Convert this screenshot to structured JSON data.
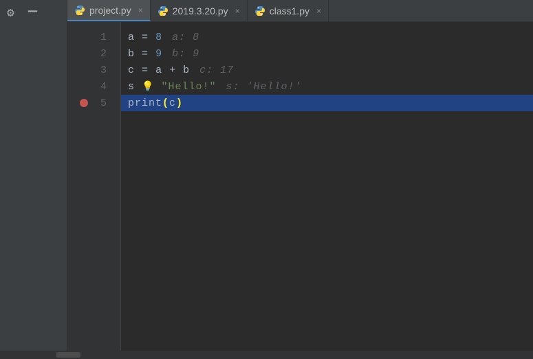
{
  "leftPanel": {
    "gear": "⚙",
    "minimize": "—"
  },
  "tabs": [
    {
      "label": "project.py",
      "active": true
    },
    {
      "label": "2019.3.20.py",
      "active": false
    },
    {
      "label": "class1.py",
      "active": false
    }
  ],
  "gutter": {
    "lines": [
      "1",
      "2",
      "3",
      "4",
      "5"
    ],
    "breakpointLine": 5
  },
  "code": {
    "line1": {
      "v": "a",
      "eq": "=",
      "n": "8",
      "hint": "a: 8"
    },
    "line2": {
      "v": "b",
      "eq": "=",
      "n": "9",
      "hint": "b: 9"
    },
    "line3": {
      "v": "c",
      "eq": "=",
      "a": "a",
      "plus": "+",
      "b": "b",
      "hint": "c: 17"
    },
    "line4": {
      "v": "s",
      "eq": "=",
      "str": "\"Hello!\"",
      "hint": "s: 'Hello!'"
    },
    "line5": {
      "fn": "print",
      "lp": "(",
      "arg": "c",
      "rp": ")"
    }
  }
}
